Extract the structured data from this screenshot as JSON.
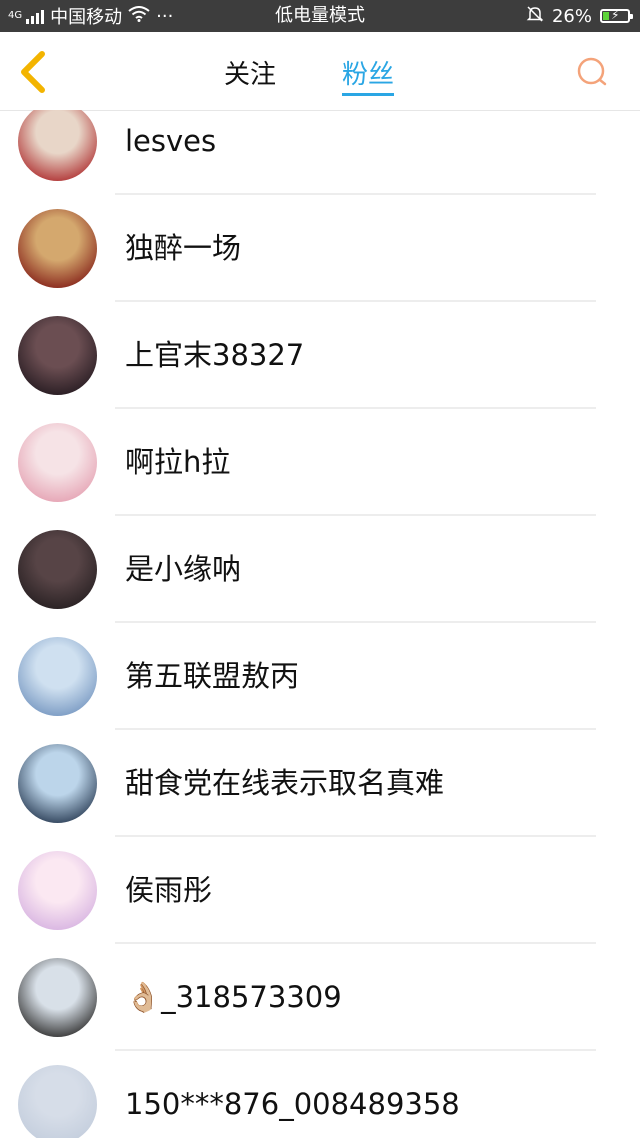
{
  "status_bar": {
    "network_type": "4G",
    "carrier": "中国移动",
    "more": "···",
    "mode_label": "低电量模式",
    "battery_percent": "26%",
    "battery_level": 0.26,
    "icons": [
      "signal-icon",
      "wifi-icon",
      "mute-bell-icon",
      "battery-charging-icon"
    ]
  },
  "nav": {
    "back_icon": "chevron-left-icon",
    "tab_follow": "关注",
    "tab_fans": "粉丝",
    "search_icon": "search-icon",
    "accent_color": "#2aa6e4",
    "back_color": "#f3b400",
    "search_color": "#f4a37a"
  },
  "fans": [
    {
      "name": "lesves",
      "avatar_colors": [
        "#e8d6c8",
        "#b23a3a"
      ]
    },
    {
      "name": "独醉一场",
      "avatar_colors": [
        "#d4a86e",
        "#8a2a1e"
      ]
    },
    {
      "name": "上官末38327",
      "avatar_colors": [
        "#6b4e52",
        "#2a1e24"
      ]
    },
    {
      "name": "啊拉h拉",
      "avatar_colors": [
        "#f6e3e6",
        "#e6a6b6"
      ]
    },
    {
      "name": "是小缘呐",
      "avatar_colors": [
        "#574446",
        "#2a2224"
      ]
    },
    {
      "name": "第五联盟敖丙",
      "avatar_colors": [
        "#cfe0f0",
        "#7c9cc4"
      ]
    },
    {
      "name": "甜食党在线表示取名真难",
      "avatar_colors": [
        "#bcd5ea",
        "#33465e"
      ]
    },
    {
      "name": "侯雨彤",
      "avatar_colors": [
        "#fbe8f2",
        "#d9b6e2"
      ]
    },
    {
      "name": "👌🏼_318573309",
      "avatar_colors": [
        "#d8e0e8",
        "#3a3a3a"
      ]
    },
    {
      "name": "150***876_008489358",
      "avatar_colors": [
        "#d6dde8",
        "#c4cedd"
      ]
    }
  ]
}
